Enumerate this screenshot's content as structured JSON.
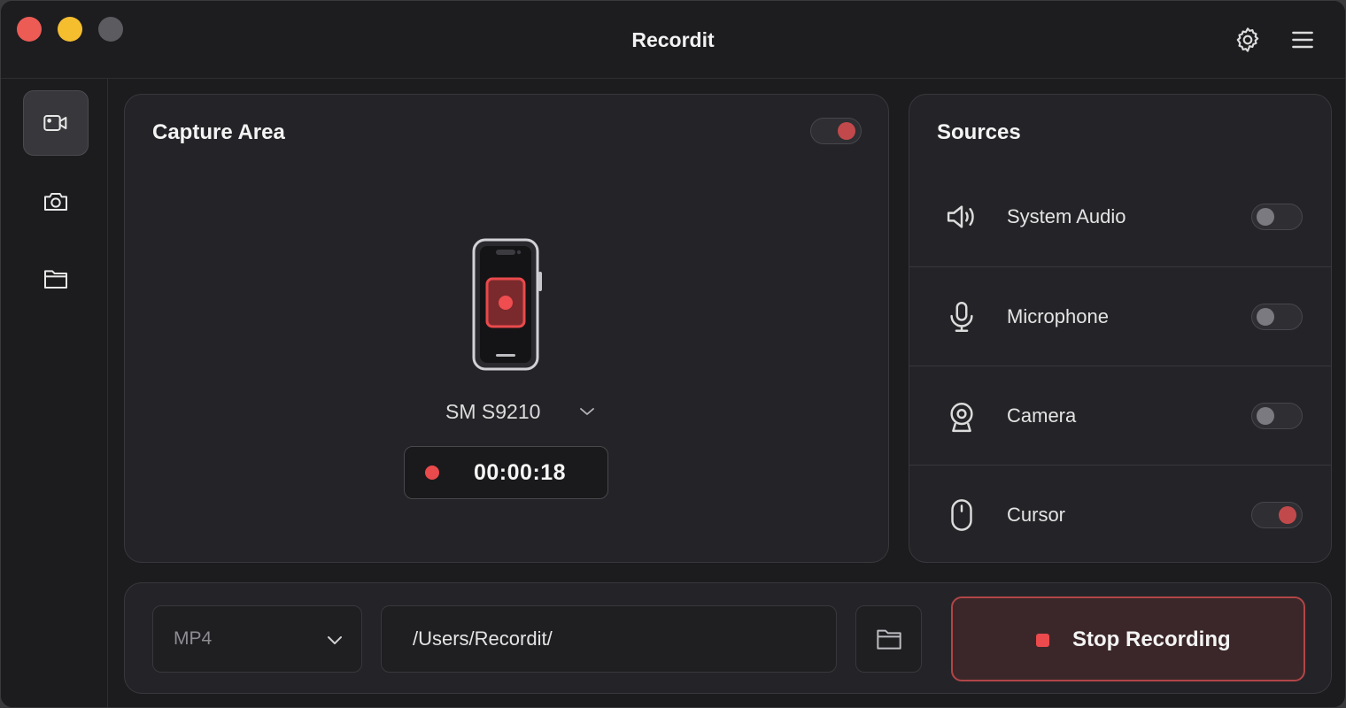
{
  "app": {
    "title": "Recordit"
  },
  "sidebar": {
    "items": [
      {
        "icon": "video-camera-icon",
        "active": true
      },
      {
        "icon": "camera-icon",
        "active": false
      },
      {
        "icon": "folder-icon",
        "active": false
      }
    ]
  },
  "capture": {
    "title": "Capture Area",
    "toggle_on": true,
    "device": "SM S9210",
    "timer": "00:00:18"
  },
  "sources": {
    "title": "Sources",
    "items": [
      {
        "label": "System Audio",
        "icon": "speaker-icon",
        "on": false
      },
      {
        "label": "Microphone",
        "icon": "microphone-icon",
        "on": false
      },
      {
        "label": "Camera",
        "icon": "webcam-icon",
        "on": false
      },
      {
        "label": "Cursor",
        "icon": "mouse-icon",
        "on": true
      }
    ]
  },
  "output": {
    "format": "MP4",
    "path": "/Users/Recordit/"
  },
  "actions": {
    "stop_label": "Stop Recording"
  },
  "colors": {
    "accent": "#c2494b",
    "record": "#e94a4c",
    "panel": "#242428"
  }
}
